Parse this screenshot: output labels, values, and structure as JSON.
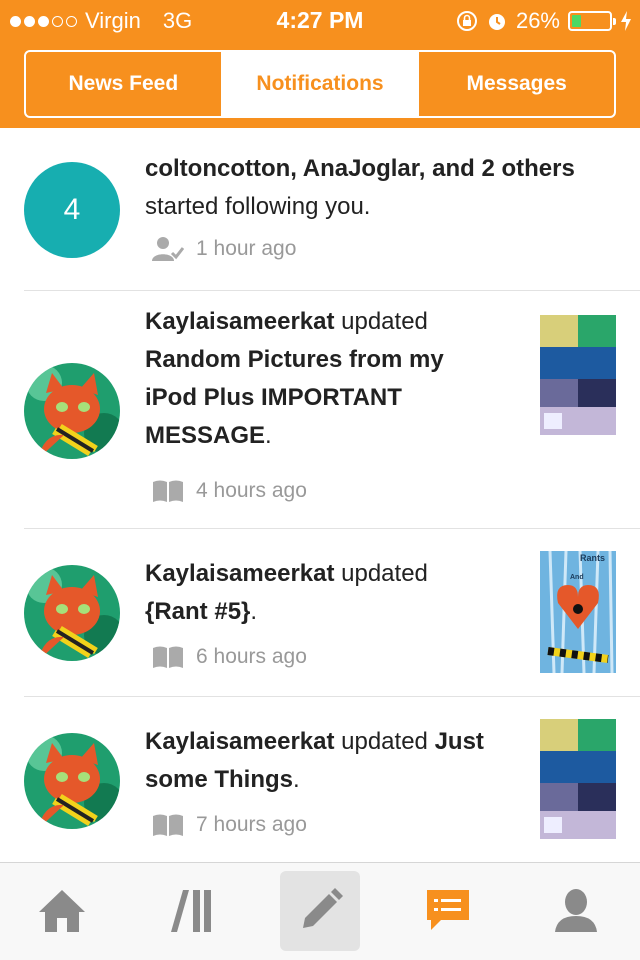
{
  "status_bar": {
    "carrier": "Virgin",
    "network": "3G",
    "time": "4:27 PM",
    "battery": "26%",
    "battery_level": 0.26,
    "signal_bars_filled": 3,
    "signal_bars_total": 5
  },
  "header": {
    "tabs": [
      {
        "label": "News Feed",
        "active": false
      },
      {
        "label": "Notifications",
        "active": true
      },
      {
        "label": "Messages",
        "active": false
      }
    ]
  },
  "notifications": [
    {
      "avatar_count": "4",
      "users": "coltoncotton, AnaJoglar, and 2 others",
      "action": "started following you.",
      "meta_icon": "follow-icon",
      "time": "1 hour ago"
    },
    {
      "user": "Kaylaisameerkat",
      "action": "updated",
      "title": "Random Pictures from my iPod Plus IMPORTANT MESSAGE",
      "meta_icon": "book-icon",
      "time": "4 hours ago"
    },
    {
      "user": "Kaylaisameerkat",
      "action": "updated",
      "title": "{Rant #5}",
      "meta_icon": "book-icon",
      "time": "6 hours ago",
      "thumb_text_1": "Rants",
      "thumb_text_2": "And"
    },
    {
      "user": "Kaylaisameerkat",
      "action": "updated",
      "title": "Just some Things",
      "meta_icon": "book-icon",
      "time": "7 hours ago"
    }
  ],
  "tab_bar": {
    "items": [
      "home-icon",
      "library-icon",
      "compose-icon",
      "messages-icon",
      "profile-icon"
    ],
    "active": "messages-icon"
  },
  "colors": {
    "brand_orange": "#f7901e",
    "teal": "#17aeb0",
    "battery_green": "#4cd964"
  }
}
